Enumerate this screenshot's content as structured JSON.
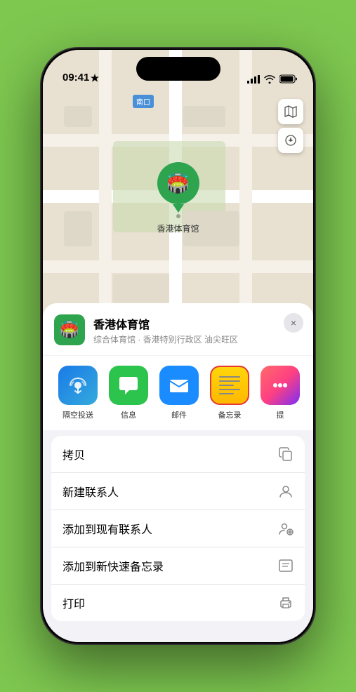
{
  "status_bar": {
    "time": "09:41",
    "location_arrow": "▲"
  },
  "map": {
    "label": "南口",
    "venue_pin_label": "香港体育馆"
  },
  "sheet": {
    "venue_name": "香港体育馆",
    "venue_sub": "综合体育馆 · 香港特别行政区 油尖旺区",
    "close_label": "×"
  },
  "share_items": [
    {
      "id": "airdrop",
      "type": "airdrop",
      "label": "隔空投送",
      "icon": "📡"
    },
    {
      "id": "messages",
      "type": "messages",
      "label": "信息",
      "icon": "💬"
    },
    {
      "id": "mail",
      "type": "mail",
      "label": "邮件",
      "icon": "✉️"
    },
    {
      "id": "notes",
      "type": "notes",
      "label": "备忘录",
      "icon": ""
    },
    {
      "id": "more",
      "type": "more",
      "label": "提",
      "icon": ""
    }
  ],
  "actions": [
    {
      "label": "拷贝",
      "icon": "copy"
    },
    {
      "label": "新建联系人",
      "icon": "person"
    },
    {
      "label": "添加到现有联系人",
      "icon": "person-add"
    },
    {
      "label": "添加到新快速备忘录",
      "icon": "note"
    },
    {
      "label": "打印",
      "icon": "print"
    }
  ],
  "colors": {
    "green": "#2ea44f",
    "accent_blue": "#1a8cff",
    "notes_yellow": "#ffd60a",
    "highlight_red": "#e53935"
  }
}
